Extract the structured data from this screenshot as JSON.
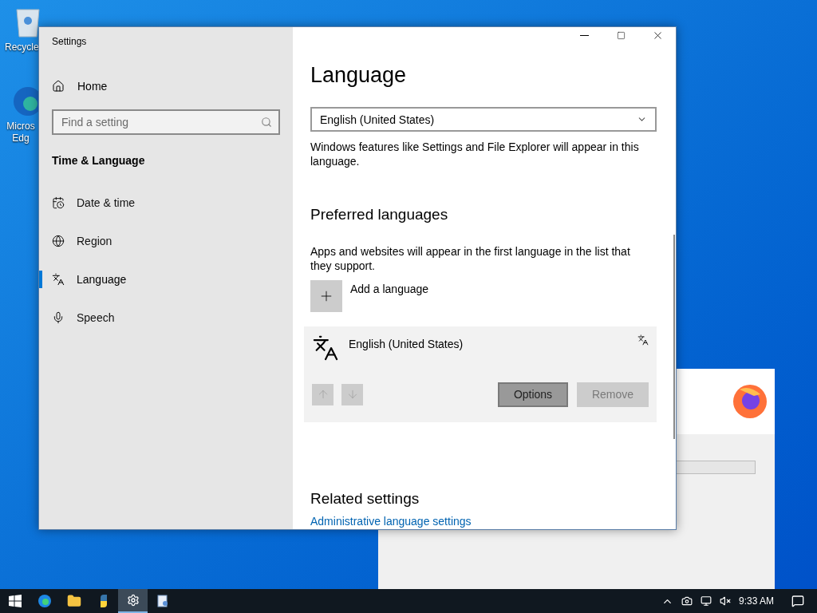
{
  "desktop_icons": [
    {
      "label": "Recycle",
      "kind": "bin"
    },
    {
      "label": "Micros Edg",
      "kind": "edge"
    }
  ],
  "window": {
    "title": "Settings"
  },
  "sidebar": {
    "home": "Home",
    "search": {
      "placeholder": "Find a setting"
    },
    "section": "Time & Language",
    "items": [
      {
        "label": "Date & time",
        "kind": "calendar",
        "selected": false
      },
      {
        "label": "Region",
        "kind": "globe",
        "selected": false
      },
      {
        "label": "Language",
        "kind": "language",
        "selected": true
      },
      {
        "label": "Speech",
        "kind": "mic",
        "selected": false
      }
    ]
  },
  "content": {
    "title": "Language",
    "display_language": {
      "value": "English (United States)",
      "description": "Windows features like Settings and File Explorer will appear in this language."
    },
    "preferred": {
      "heading": "Preferred languages",
      "description": "Apps and websites will appear in the first language in the list that they support.",
      "add": "Add a language",
      "languages": [
        {
          "name": "English (United States)",
          "selected": true,
          "up_disabled": true,
          "down_disabled": true,
          "options": "Options",
          "remove": "Remove",
          "remove_disabled": true
        }
      ]
    },
    "related": {
      "heading": "Related settings",
      "link": "Administrative language settings"
    }
  },
  "taskbar": {
    "apps": [
      {
        "kind": "start",
        "selected": false
      },
      {
        "kind": "edge",
        "selected": false
      },
      {
        "kind": "folder",
        "selected": false
      },
      {
        "kind": "python",
        "selected": false
      },
      {
        "kind": "gear",
        "selected": true
      },
      {
        "kind": "app",
        "selected": false
      }
    ],
    "time": "9:33 AM"
  }
}
